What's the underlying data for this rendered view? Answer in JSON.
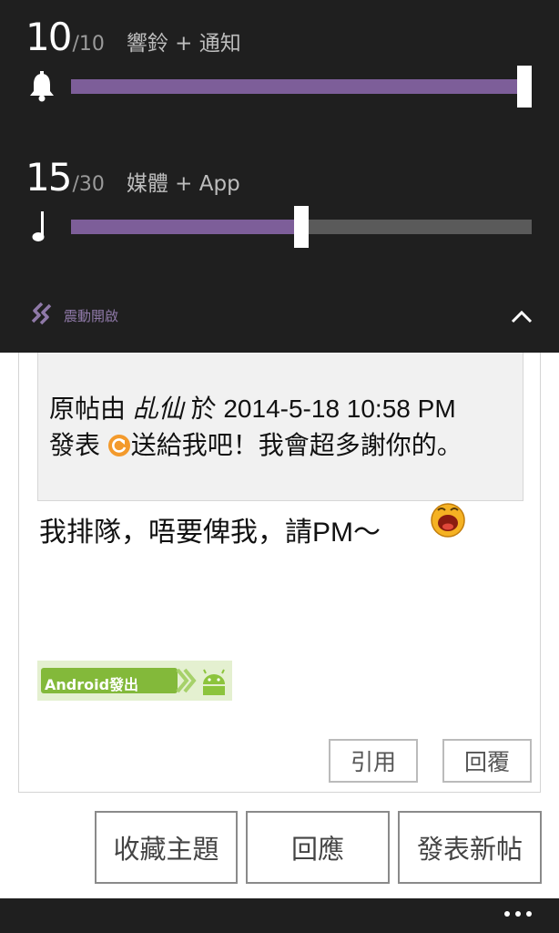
{
  "volume": {
    "ringer": {
      "value": "10",
      "max": "/10",
      "label": "響鈴 + 通知",
      "level": 1.0,
      "icon": "bell-icon"
    },
    "media": {
      "value": "15",
      "max": "/30",
      "label": "媒體 + App",
      "level": 0.5,
      "icon": "music-note-icon"
    },
    "vibrate_label": "震動開啟",
    "accent": "#7d5e99"
  },
  "post": {
    "quote": {
      "prefix": "原帖由 ",
      "author": "乩仙",
      "middle": " 於 2014-5-18 10:58 PM",
      "line2_start": "發表 ",
      "line2_end": "送給我吧！我會超多謝你的。"
    },
    "reply_text": "我排隊，唔要俾我，請PM～",
    "badge_text": "Android發出",
    "quote_button": "引用",
    "reply_button": "回覆"
  },
  "actions": {
    "favorite": "收藏主題",
    "respond": "回應",
    "new_post": "發表新帖"
  }
}
